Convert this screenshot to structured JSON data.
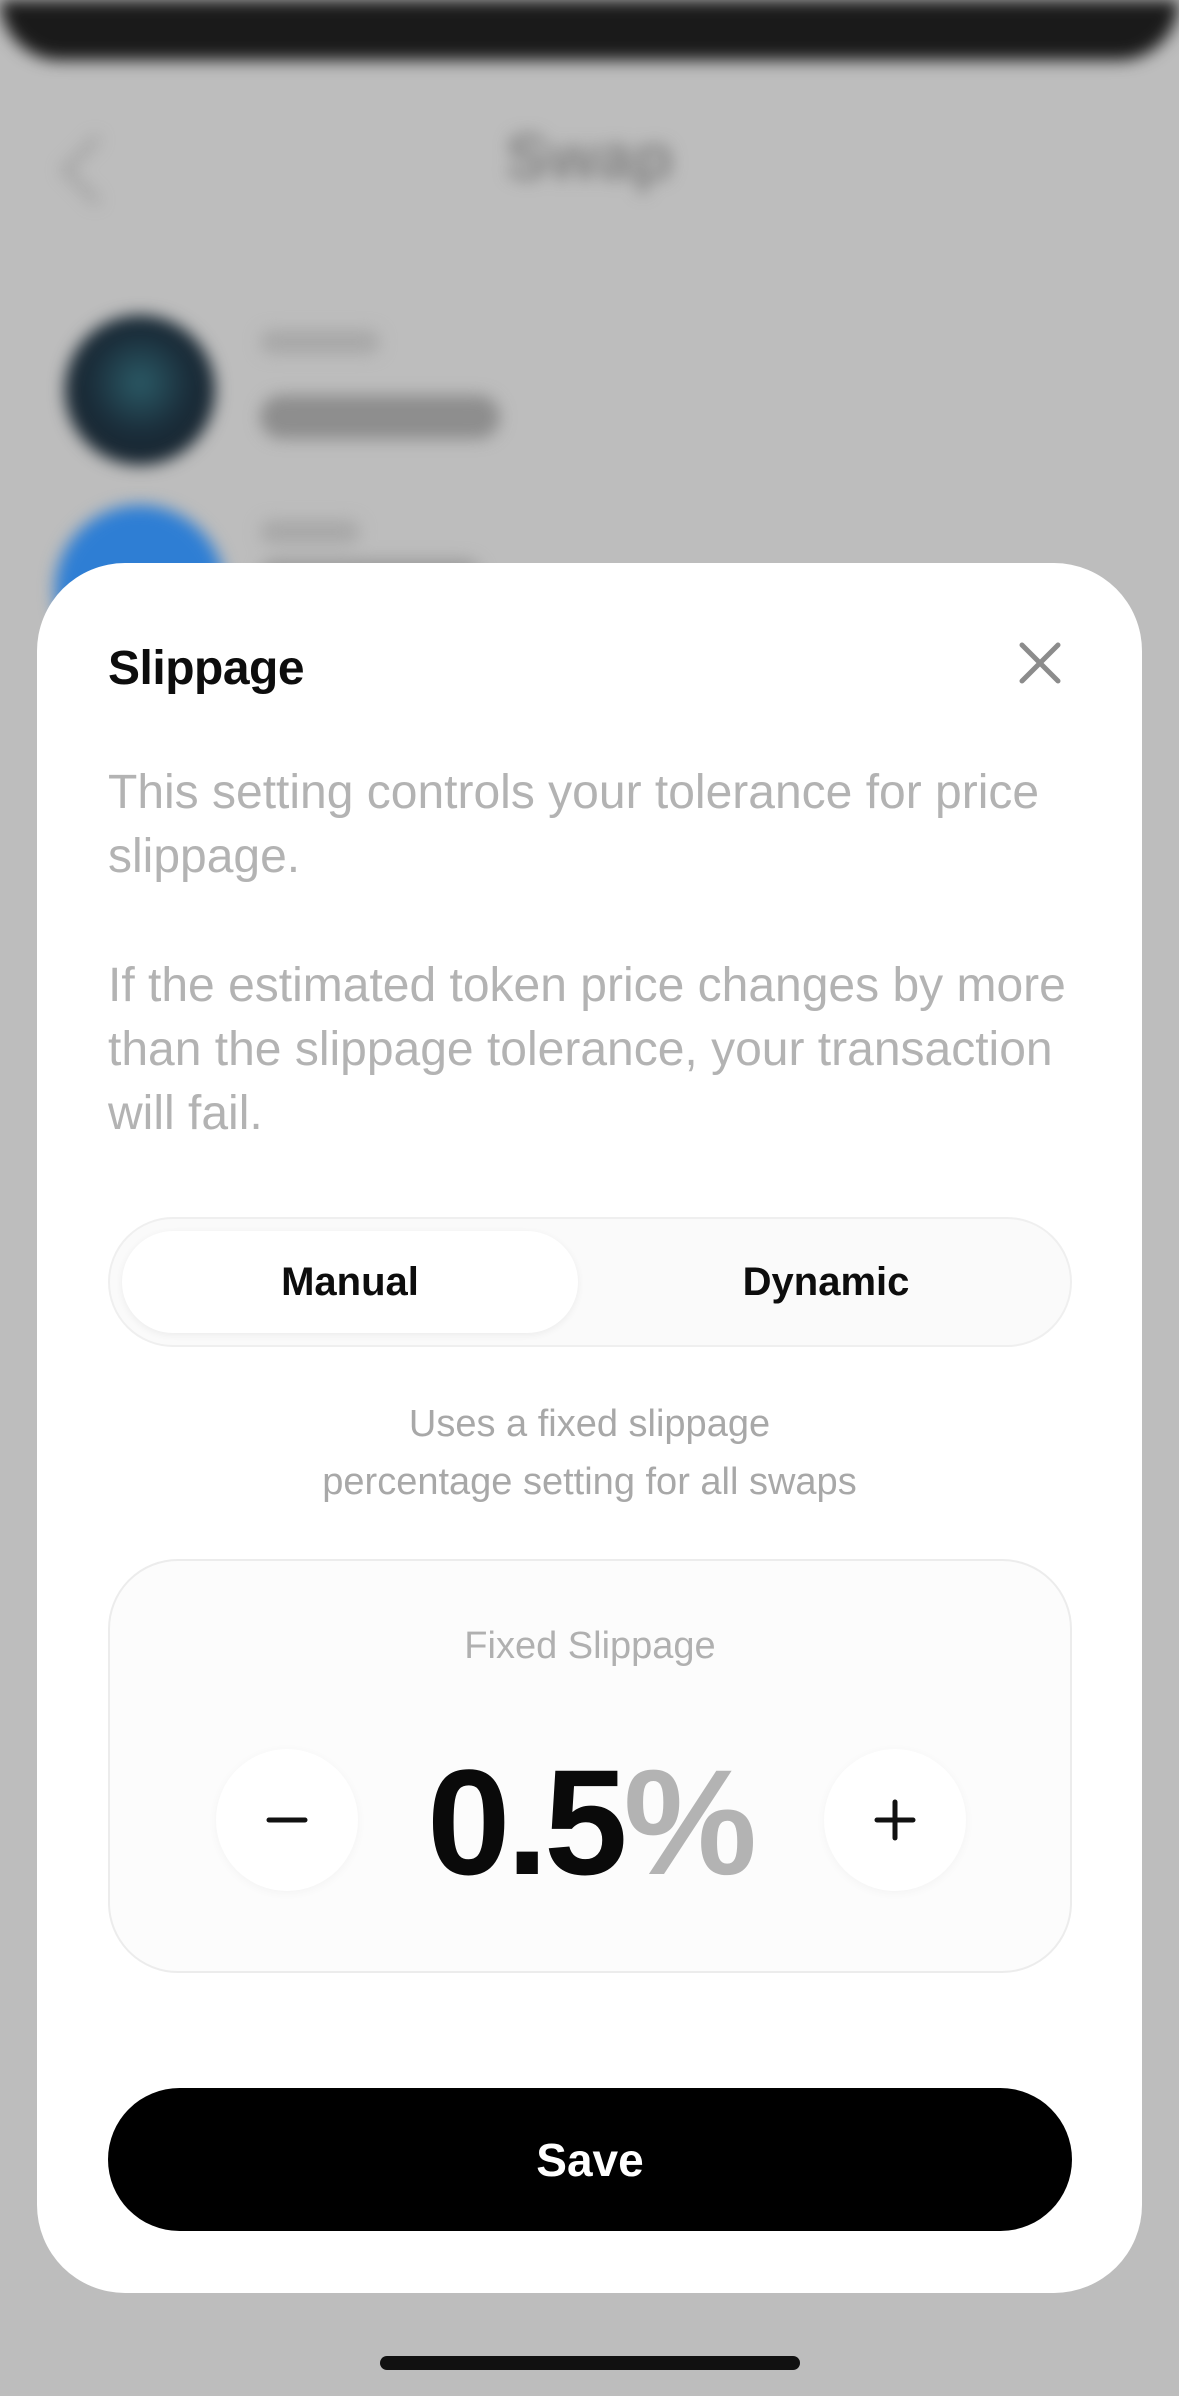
{
  "background": {
    "title": "Swap"
  },
  "sheet": {
    "title": "Slippage",
    "description_1": "This setting controls your tolerance for price slippage.",
    "description_2": "If the estimated token price changes by more than the slippage tolerance, your transaction will fail.",
    "close_icon": "close-icon"
  },
  "mode_toggle": {
    "options": [
      "Manual",
      "Dynamic"
    ],
    "selected": "Manual"
  },
  "mode_description": {
    "line1": "Uses a fixed slippage",
    "line2": "percentage setting for all swaps"
  },
  "fixed_slippage": {
    "label": "Fixed Slippage",
    "value": "0.5",
    "unit": "%",
    "decrement_icon": "minus-icon",
    "increment_icon": "plus-icon"
  },
  "actions": {
    "save_label": "Save"
  },
  "colors": {
    "accent": "#000000",
    "muted_text": "#b3b3b3",
    "sheet_bg": "#ffffff"
  }
}
